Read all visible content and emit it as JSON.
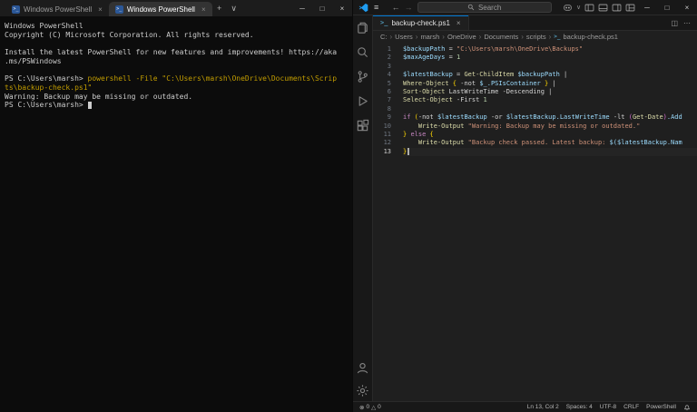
{
  "icons": {
    "close": "×",
    "plus": "+",
    "chevron_down": "∨",
    "minimize": "─",
    "maximize": "□",
    "more": "⋯",
    "split": "◫",
    "back": "←",
    "forward": "→",
    "menu": "≡",
    "breadcrumb_chevron": "›",
    "error": "⊗",
    "warning": "△",
    "ps_prompt": ">_"
  },
  "terminal": {
    "tabs": [
      {
        "label": "Windows PowerShell"
      },
      {
        "label": "Windows PowerShell"
      }
    ],
    "lines": [
      {
        "segs": [
          {
            "t": "Windows PowerShell",
            "c": "plain"
          }
        ]
      },
      {
        "segs": [
          {
            "t": "Copyright (C) Microsoft Corporation. All rights reserved.",
            "c": "plain"
          }
        ]
      },
      {
        "segs": []
      },
      {
        "segs": [
          {
            "t": "Install the latest PowerShell for new features and improvements! https://aka",
            "c": "plain"
          }
        ]
      },
      {
        "segs": [
          {
            "t": ".ms/PSWindows",
            "c": "plain"
          }
        ]
      },
      {
        "segs": []
      },
      {
        "segs": [
          {
            "t": "PS C:\\Users\\marsh> ",
            "c": "plain"
          },
          {
            "t": "powershell ",
            "c": "cmd"
          },
          {
            "t": "-File ",
            "c": "cmd"
          },
          {
            "t": "\"C:\\Users\\marsh\\OneDrive\\Documents\\Scrip",
            "c": "cmd"
          }
        ]
      },
      {
        "segs": [
          {
            "t": "ts\\backup-check.ps1\"",
            "c": "cmd"
          }
        ]
      },
      {
        "segs": [
          {
            "t": "Warning: Backup may be missing or outdated.",
            "c": "plain"
          }
        ]
      },
      {
        "segs": [
          {
            "t": "PS C:\\Users\\marsh> ",
            "c": "plain"
          },
          {
            "t": "",
            "c": "cursor"
          }
        ]
      }
    ]
  },
  "vscode": {
    "titlebar": {
      "search_placeholder": "Search"
    },
    "tab": {
      "label": "backup-check.ps1"
    },
    "breadcrumbs": [
      "C:",
      "Users",
      "marsh",
      "OneDrive",
      "Documents",
      "scripts"
    ],
    "breadcrumb_file": {
      "label": "backup-check.ps1"
    },
    "code_lines": [
      {
        "n": "1",
        "segs": [
          {
            "t": "$backupPath",
            "c": "var"
          },
          {
            "t": " = ",
            "c": "op"
          },
          {
            "t": "\"C:\\Users\\marsh\\OneDrive\\Backups\"",
            "c": "str"
          }
        ]
      },
      {
        "n": "2",
        "segs": [
          {
            "t": "$maxAgeDays",
            "c": "var"
          },
          {
            "t": " = ",
            "c": "op"
          },
          {
            "t": "1",
            "c": "num"
          }
        ]
      },
      {
        "n": "3",
        "segs": []
      },
      {
        "n": "4",
        "segs": [
          {
            "t": "$latestBackup",
            "c": "var"
          },
          {
            "t": " = ",
            "c": "op"
          },
          {
            "t": "Get-ChildItem",
            "c": "fn"
          },
          {
            "t": " ",
            "c": "op"
          },
          {
            "t": "$backupPath",
            "c": "var"
          },
          {
            "t": " |",
            "c": "op"
          }
        ]
      },
      {
        "n": "5",
        "segs": [
          {
            "t": "Where-Object",
            "c": "fn"
          },
          {
            "t": " ",
            "c": "op"
          },
          {
            "t": "{",
            "c": "b1"
          },
          {
            "t": " -not ",
            "c": "op"
          },
          {
            "t": "$_",
            "c": "var"
          },
          {
            "t": ".PSIsContainer",
            "c": "mem"
          },
          {
            "t": " ",
            "c": "op"
          },
          {
            "t": "}",
            "c": "b1"
          },
          {
            "t": " |",
            "c": "op"
          }
        ]
      },
      {
        "n": "6",
        "segs": [
          {
            "t": "Sort-Object",
            "c": "fn"
          },
          {
            "t": " LastWriteTime ",
            "c": "plain"
          },
          {
            "t": "-Descending",
            "c": "param"
          },
          {
            "t": " |",
            "c": "op"
          }
        ]
      },
      {
        "n": "7",
        "segs": [
          {
            "t": "Select-Object",
            "c": "fn"
          },
          {
            "t": " ",
            "c": "op"
          },
          {
            "t": "-First",
            "c": "param"
          },
          {
            "t": " ",
            "c": "op"
          },
          {
            "t": "1",
            "c": "num"
          }
        ]
      },
      {
        "n": "8",
        "segs": []
      },
      {
        "n": "9",
        "segs": [
          {
            "t": "if ",
            "c": "kw"
          },
          {
            "t": "(",
            "c": "b1"
          },
          {
            "t": "-not ",
            "c": "op"
          },
          {
            "t": "$latestBackup",
            "c": "var"
          },
          {
            "t": " -or ",
            "c": "op"
          },
          {
            "t": "$latestBackup",
            "c": "var"
          },
          {
            "t": ".LastWriteTime",
            "c": "mem"
          },
          {
            "t": " -lt ",
            "c": "op"
          },
          {
            "t": "(",
            "c": "b2"
          },
          {
            "t": "Get-Date",
            "c": "fn"
          },
          {
            "t": ")",
            "c": "b2"
          },
          {
            "t": ".Add",
            "c": "mem"
          }
        ]
      },
      {
        "n": "10",
        "segs": [
          {
            "t": "    ",
            "c": "plain"
          },
          {
            "t": "Write-Output",
            "c": "fn"
          },
          {
            "t": " ",
            "c": "op"
          },
          {
            "t": "\"Warning: Backup may be missing or outdated.\"",
            "c": "str"
          }
        ]
      },
      {
        "n": "11",
        "segs": [
          {
            "t": "}",
            "c": "b1"
          },
          {
            "t": " ",
            "c": "op"
          },
          {
            "t": "else",
            "c": "kw"
          },
          {
            "t": " ",
            "c": "op"
          },
          {
            "t": "{",
            "c": "b1"
          }
        ]
      },
      {
        "n": "12",
        "segs": [
          {
            "t": "    ",
            "c": "plain"
          },
          {
            "t": "Write-Output",
            "c": "fn"
          },
          {
            "t": " ",
            "c": "op"
          },
          {
            "t": "\"Backup check passed. Latest backup: ",
            "c": "str"
          },
          {
            "t": "$(",
            "c": "var"
          },
          {
            "t": "$latestBackup",
            "c": "var"
          },
          {
            "t": ".Nam",
            "c": "mem"
          }
        ]
      },
      {
        "n": "13",
        "current": true,
        "cursor": true,
        "segs": [
          {
            "t": "}",
            "c": "b1"
          }
        ]
      }
    ],
    "status": {
      "errors": "0",
      "warnings": "0",
      "line_col": "Ln 13, Col 2",
      "spaces": "Spaces: 4",
      "encoding": "UTF-8",
      "eol": "CRLF",
      "language": "PowerShell"
    }
  }
}
